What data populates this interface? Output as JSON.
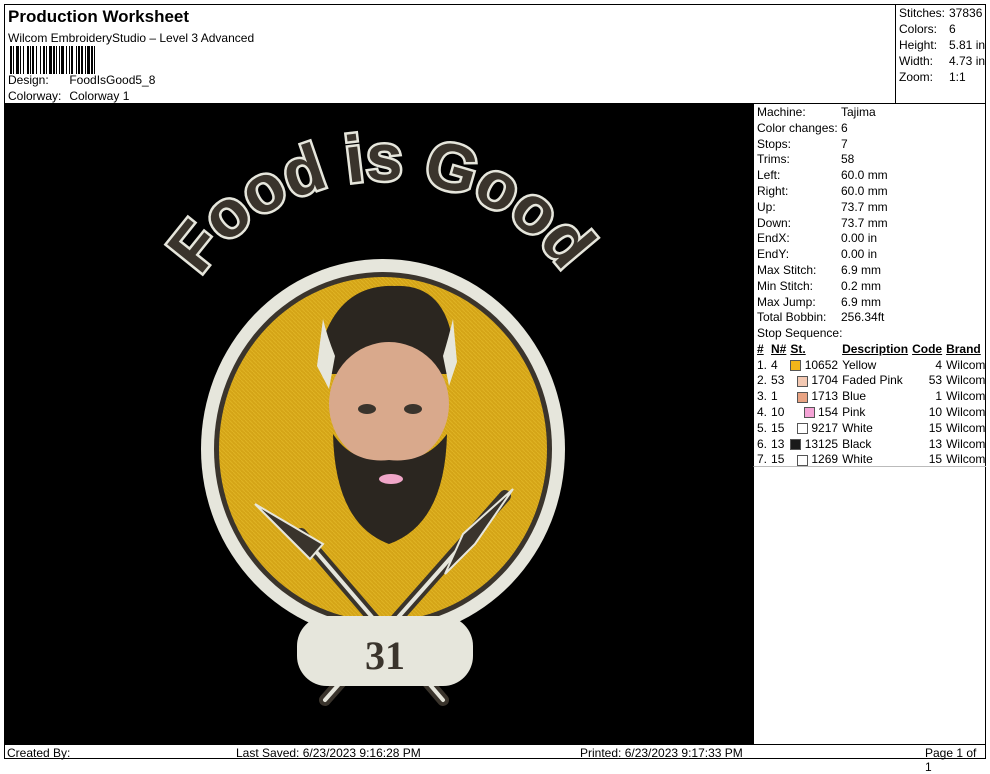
{
  "header": {
    "title": "Production Worksheet",
    "subtitle": "Wilcom EmbroideryStudio – Level 3 Advanced",
    "design_label": "Design:",
    "design_value": "FoodIsGood5_8",
    "colorway_label": "Colorway:",
    "colorway_value": "Colorway 1"
  },
  "summary": [
    {
      "label": "Stitches:",
      "value": "37836"
    },
    {
      "label": "Colors:",
      "value": "6"
    },
    {
      "label": "Height:",
      "value": "5.81 in"
    },
    {
      "label": "Width:",
      "value": "4.73 in"
    },
    {
      "label": "Zoom:",
      "value": "1:1"
    }
  ],
  "machine_info": [
    {
      "label": "Machine:",
      "value": "Tajima"
    },
    {
      "label": "Color changes:",
      "value": "6"
    },
    {
      "label": "Stops:",
      "value": "7"
    },
    {
      "label": "Trims:",
      "value": "58"
    },
    {
      "label": "Left:",
      "value": "60.0 mm"
    },
    {
      "label": "Right:",
      "value": "60.0 mm"
    },
    {
      "label": "Up:",
      "value": "73.7 mm"
    },
    {
      "label": "Down:",
      "value": "73.7 mm"
    },
    {
      "label": "EndX:",
      "value": "0.00 in"
    },
    {
      "label": "EndY:",
      "value": "0.00 in"
    },
    {
      "label": "Max Stitch:",
      "value": "6.9 mm"
    },
    {
      "label": "Min Stitch:",
      "value": "0.2 mm"
    },
    {
      "label": "Max Jump:",
      "value": "6.9 mm"
    },
    {
      "label": "Total Bobbin:",
      "value": "256.34ft"
    }
  ],
  "stop_sequence": {
    "title": "Stop Sequence:",
    "columns": [
      "#",
      "N#",
      "St.",
      "Description",
      "Code",
      "Brand"
    ],
    "rows": [
      {
        "idx": "1.",
        "n": "4",
        "color": "#f2b51a",
        "st": "10652",
        "desc": "Yellow",
        "code": "4",
        "brand": "Wilcom"
      },
      {
        "idx": "2.",
        "n": "53",
        "color": "#f3c9b3",
        "st": "1704",
        "desc": "Faded Pink",
        "code": "53",
        "brand": "Wilcom"
      },
      {
        "idx": "3.",
        "n": "1",
        "color": "#e8a383",
        "st": "1713",
        "desc": "Blue",
        "code": "1",
        "brand": "Wilcom"
      },
      {
        "idx": "4.",
        "n": "10",
        "color": "#f5a3d6",
        "st": "154",
        "desc": "Pink",
        "code": "10",
        "brand": "Wilcom"
      },
      {
        "idx": "5.",
        "n": "15",
        "color": "#ffffff",
        "st": "9217",
        "desc": "White",
        "code": "15",
        "brand": "Wilcom"
      },
      {
        "idx": "6.",
        "n": "13",
        "color": "#1a1a1a",
        "st": "13125",
        "desc": "Black",
        "code": "13",
        "brand": "Wilcom"
      },
      {
        "idx": "7.",
        "n": "15",
        "color": "#ffffff",
        "st": "1269",
        "desc": "White",
        "code": "15",
        "brand": "Wilcom"
      }
    ]
  },
  "artwork": {
    "headline": "Food is Good",
    "number": "31",
    "colors": {
      "background": "#000000",
      "yellow": "#d4a417",
      "ring": "#e6e6dc",
      "dark": "#3a342c",
      "skin": "#d9a98c",
      "hair": "#2b2620"
    }
  },
  "footer": {
    "created_by": "Created By:",
    "last_saved": "Last Saved: 6/23/2023 9:16:28 PM",
    "printed": "Printed: 6/23/2023 9:17:33 PM",
    "page": "Page 1 of 1"
  }
}
